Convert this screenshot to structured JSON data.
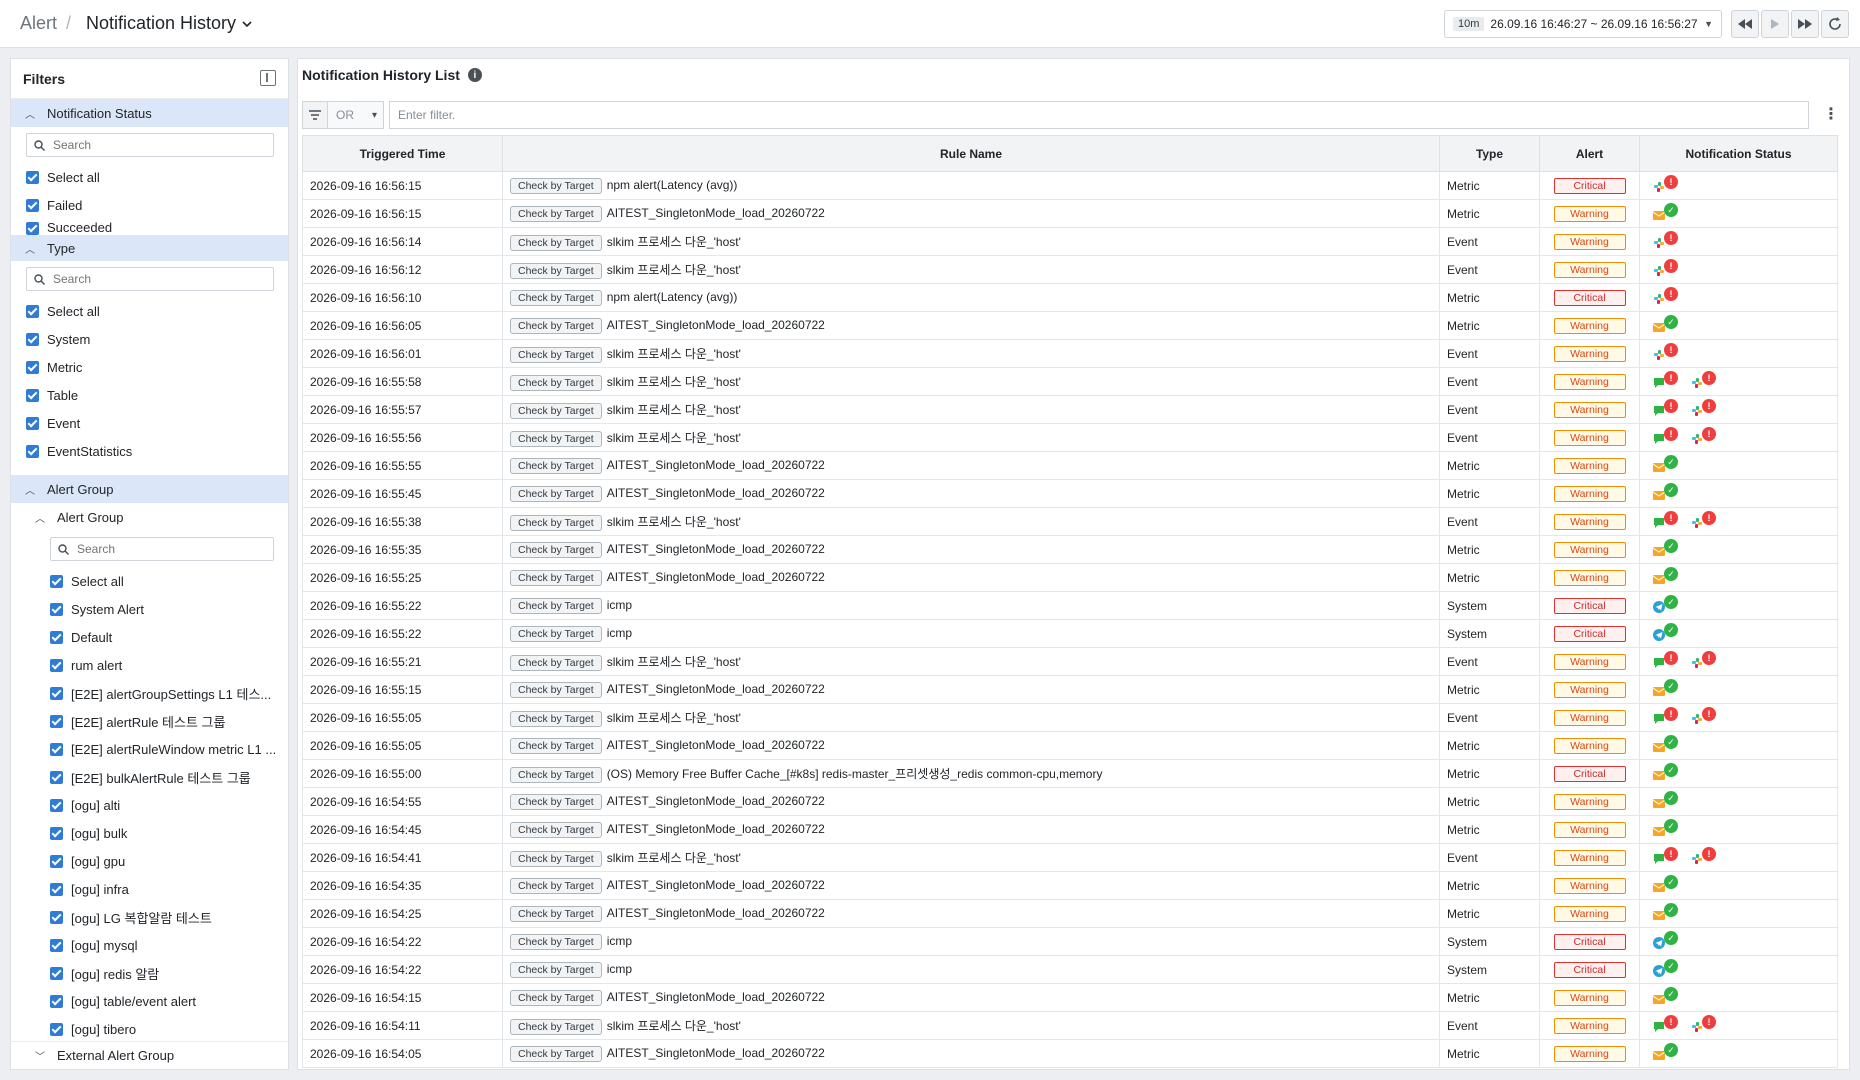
{
  "header": {
    "breadcrumb_root": "Alert",
    "breadcrumb_sep": "/",
    "page_title": "Notification History",
    "time_badge": "10m",
    "time_range": "26.09.16 16:46:27 ~ 26.09.16 16:56:27"
  },
  "filters": {
    "title": "Filters",
    "search_placeholder": "Search",
    "notification_status": {
      "label": "Notification Status",
      "items": [
        "Select all",
        "Failed",
        "Succeeded"
      ]
    },
    "type": {
      "label": "Type",
      "items": [
        "Select all",
        "System",
        "Metric",
        "Table",
        "Event",
        "EventStatistics"
      ]
    },
    "alert_group": {
      "label": "Alert Group",
      "sub_label": "Alert Group",
      "items": [
        "Select all",
        "System Alert",
        "Default",
        "rum alert",
        "[E2E] alertGroupSettings L1 테스...",
        "[E2E] alertRule 테스트 그룹",
        "[E2E] alertRuleWindow metric L1 ...",
        "[E2E] bulkAlertRule 테스트 그룹",
        "[ogu] alti",
        "[ogu] bulk",
        "[ogu] gpu",
        "[ogu] infra",
        "[ogu] LG 복합알람 테스트",
        "[ogu] mysql",
        "[ogu] redis 알람",
        "[ogu] table/event alert",
        "[ogu] tibero"
      ],
      "external_label": "External Alert Group"
    }
  },
  "main": {
    "title": "Notification History List",
    "filter_logic": "OR",
    "filter_placeholder": "Enter filter.",
    "columns": [
      "Triggered Time",
      "Rule Name",
      "Type",
      "Alert",
      "Notification Status"
    ],
    "tag_label": "Check by Target",
    "rows": [
      {
        "time": "2026-09-16 16:56:15",
        "rule": "npm alert(Latency (avg))",
        "type": "Metric",
        "alert": "Critical",
        "ns": [
          {
            "ch": "slack",
            "s": "err"
          }
        ]
      },
      {
        "time": "2026-09-16 16:56:15",
        "rule": "AITEST_SingletonMode_load_20260722",
        "type": "Metric",
        "alert": "Warning",
        "ns": [
          {
            "ch": "mail",
            "s": "ok"
          }
        ]
      },
      {
        "time": "2026-09-16 16:56:14",
        "rule": "slkim 프로세스 다운_'host'",
        "type": "Event",
        "alert": "Warning",
        "ns": [
          {
            "ch": "slack",
            "s": "err"
          }
        ]
      },
      {
        "time": "2026-09-16 16:56:12",
        "rule": "slkim 프로세스 다운_'host'",
        "type": "Event",
        "alert": "Warning",
        "ns": [
          {
            "ch": "slack",
            "s": "err"
          }
        ]
      },
      {
        "time": "2026-09-16 16:56:10",
        "rule": "npm alert(Latency (avg))",
        "type": "Metric",
        "alert": "Critical",
        "ns": [
          {
            "ch": "slack",
            "s": "err"
          }
        ]
      },
      {
        "time": "2026-09-16 16:56:05",
        "rule": "AITEST_SingletonMode_load_20260722",
        "type": "Metric",
        "alert": "Warning",
        "ns": [
          {
            "ch": "mail",
            "s": "ok"
          }
        ]
      },
      {
        "time": "2026-09-16 16:56:01",
        "rule": "slkim 프로세스 다운_'host'",
        "type": "Event",
        "alert": "Warning",
        "ns": [
          {
            "ch": "slack",
            "s": "err"
          }
        ]
      },
      {
        "time": "2026-09-16 16:55:58",
        "rule": "slkim 프로세스 다운_'host'",
        "type": "Event",
        "alert": "Warning",
        "ns": [
          {
            "ch": "chat",
            "s": "err"
          },
          {
            "ch": "slack",
            "s": "err"
          }
        ]
      },
      {
        "time": "2026-09-16 16:55:57",
        "rule": "slkim 프로세스 다운_'host'",
        "type": "Event",
        "alert": "Warning",
        "ns": [
          {
            "ch": "chat",
            "s": "err"
          },
          {
            "ch": "slack",
            "s": "err"
          }
        ]
      },
      {
        "time": "2026-09-16 16:55:56",
        "rule": "slkim 프로세스 다운_'host'",
        "type": "Event",
        "alert": "Warning",
        "ns": [
          {
            "ch": "chat",
            "s": "err"
          },
          {
            "ch": "slack",
            "s": "err"
          }
        ]
      },
      {
        "time": "2026-09-16 16:55:55",
        "rule": "AITEST_SingletonMode_load_20260722",
        "type": "Metric",
        "alert": "Warning",
        "ns": [
          {
            "ch": "mail",
            "s": "ok"
          }
        ]
      },
      {
        "time": "2026-09-16 16:55:45",
        "rule": "AITEST_SingletonMode_load_20260722",
        "type": "Metric",
        "alert": "Warning",
        "ns": [
          {
            "ch": "mail",
            "s": "ok"
          }
        ]
      },
      {
        "time": "2026-09-16 16:55:38",
        "rule": "slkim 프로세스 다운_'host'",
        "type": "Event",
        "alert": "Warning",
        "ns": [
          {
            "ch": "chat",
            "s": "err"
          },
          {
            "ch": "slack",
            "s": "err"
          }
        ]
      },
      {
        "time": "2026-09-16 16:55:35",
        "rule": "AITEST_SingletonMode_load_20260722",
        "type": "Metric",
        "alert": "Warning",
        "ns": [
          {
            "ch": "mail",
            "s": "ok"
          }
        ]
      },
      {
        "time": "2026-09-16 16:55:25",
        "rule": "AITEST_SingletonMode_load_20260722",
        "type": "Metric",
        "alert": "Warning",
        "ns": [
          {
            "ch": "mail",
            "s": "ok"
          }
        ]
      },
      {
        "time": "2026-09-16 16:55:22",
        "rule": "icmp",
        "type": "System",
        "alert": "Critical",
        "ns": [
          {
            "ch": "telegram",
            "s": "ok"
          }
        ]
      },
      {
        "time": "2026-09-16 16:55:22",
        "rule": "icmp",
        "type": "System",
        "alert": "Critical",
        "ns": [
          {
            "ch": "telegram",
            "s": "ok"
          }
        ]
      },
      {
        "time": "2026-09-16 16:55:21",
        "rule": "slkim 프로세스 다운_'host'",
        "type": "Event",
        "alert": "Warning",
        "ns": [
          {
            "ch": "chat",
            "s": "err"
          },
          {
            "ch": "slack",
            "s": "err"
          }
        ]
      },
      {
        "time": "2026-09-16 16:55:15",
        "rule": "AITEST_SingletonMode_load_20260722",
        "type": "Metric",
        "alert": "Warning",
        "ns": [
          {
            "ch": "mail",
            "s": "ok"
          }
        ]
      },
      {
        "time": "2026-09-16 16:55:05",
        "rule": "slkim 프로세스 다운_'host'",
        "type": "Event",
        "alert": "Warning",
        "ns": [
          {
            "ch": "chat",
            "s": "err"
          },
          {
            "ch": "slack",
            "s": "err"
          }
        ]
      },
      {
        "time": "2026-09-16 16:55:05",
        "rule": "AITEST_SingletonMode_load_20260722",
        "type": "Metric",
        "alert": "Warning",
        "ns": [
          {
            "ch": "mail",
            "s": "ok"
          }
        ]
      },
      {
        "time": "2026-09-16 16:55:00",
        "rule": "(OS) Memory Free Buffer Cache_[#k8s] redis-master_프리셋생성_redis common-cpu,memory",
        "type": "Metric",
        "alert": "Critical",
        "ns": [
          {
            "ch": "mail",
            "s": "ok"
          }
        ]
      },
      {
        "time": "2026-09-16 16:54:55",
        "rule": "AITEST_SingletonMode_load_20260722",
        "type": "Metric",
        "alert": "Warning",
        "ns": [
          {
            "ch": "mail",
            "s": "ok"
          }
        ]
      },
      {
        "time": "2026-09-16 16:54:45",
        "rule": "AITEST_SingletonMode_load_20260722",
        "type": "Metric",
        "alert": "Warning",
        "ns": [
          {
            "ch": "mail",
            "s": "ok"
          }
        ]
      },
      {
        "time": "2026-09-16 16:54:41",
        "rule": "slkim 프로세스 다운_'host'",
        "type": "Event",
        "alert": "Warning",
        "ns": [
          {
            "ch": "chat",
            "s": "err"
          },
          {
            "ch": "slack",
            "s": "err"
          }
        ]
      },
      {
        "time": "2026-09-16 16:54:35",
        "rule": "AITEST_SingletonMode_load_20260722",
        "type": "Metric",
        "alert": "Warning",
        "ns": [
          {
            "ch": "mail",
            "s": "ok"
          }
        ]
      },
      {
        "time": "2026-09-16 16:54:25",
        "rule": "AITEST_SingletonMode_load_20260722",
        "type": "Metric",
        "alert": "Warning",
        "ns": [
          {
            "ch": "mail",
            "s": "ok"
          }
        ]
      },
      {
        "time": "2026-09-16 16:54:22",
        "rule": "icmp",
        "type": "System",
        "alert": "Critical",
        "ns": [
          {
            "ch": "telegram",
            "s": "ok"
          }
        ]
      },
      {
        "time": "2026-09-16 16:54:22",
        "rule": "icmp",
        "type": "System",
        "alert": "Critical",
        "ns": [
          {
            "ch": "telegram",
            "s": "ok"
          }
        ]
      },
      {
        "time": "2026-09-16 16:54:15",
        "rule": "AITEST_SingletonMode_load_20260722",
        "type": "Metric",
        "alert": "Warning",
        "ns": [
          {
            "ch": "mail",
            "s": "ok"
          }
        ]
      },
      {
        "time": "2026-09-16 16:54:11",
        "rule": "slkim 프로세스 다운_'host'",
        "type": "Event",
        "alert": "Warning",
        "ns": [
          {
            "ch": "chat",
            "s": "err"
          },
          {
            "ch": "slack",
            "s": "err"
          }
        ]
      },
      {
        "time": "2026-09-16 16:54:05",
        "rule": "AITEST_SingletonMode_load_20260722",
        "type": "Metric",
        "alert": "Warning",
        "ns": [
          {
            "ch": "mail",
            "s": "ok"
          }
        ]
      }
    ]
  },
  "colors": {
    "accent": "#2f7bd6",
    "critical": "#e03131",
    "warning": "#f08c00",
    "success": "#2fb344",
    "section_bg": "#dbe7f8"
  }
}
